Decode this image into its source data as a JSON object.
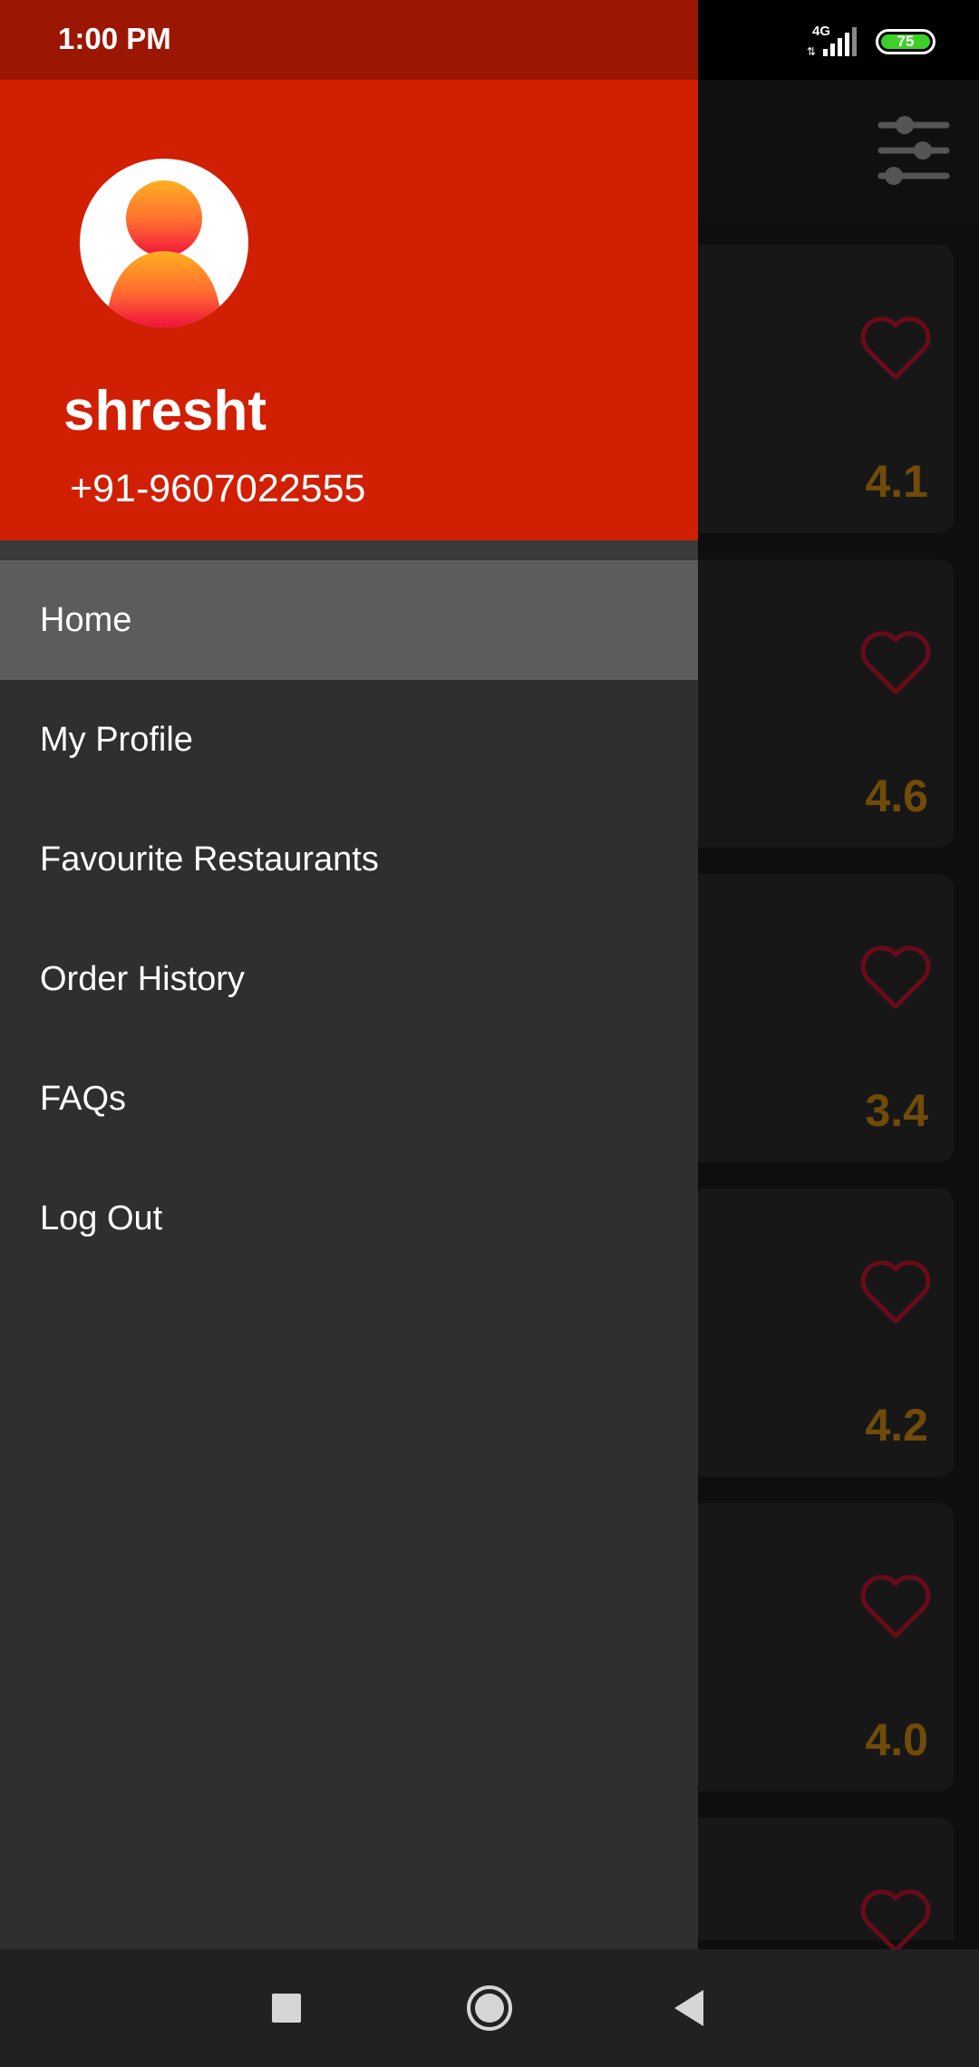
{
  "status_bar": {
    "time": "1:00 PM",
    "network": "4G",
    "battery": "75",
    "battery_level": 0.75
  },
  "drawer": {
    "user": {
      "name": "shresht",
      "phone": "+91-9607022555"
    },
    "menu": [
      {
        "label": "Home",
        "active": true
      },
      {
        "label": "My Profile",
        "active": false
      },
      {
        "label": "Favourite Restaurants",
        "active": false
      },
      {
        "label": "Order History",
        "active": false
      },
      {
        "label": "FAQs",
        "active": false
      },
      {
        "label": "Log Out",
        "active": false
      }
    ]
  },
  "background_list": {
    "filter_icon": "sliders-icon",
    "cards": [
      {
        "rating": "4.1",
        "icon": "heart-outline-icon"
      },
      {
        "rating": "4.6",
        "icon": "heart-outline-icon"
      },
      {
        "rating": "3.4",
        "icon": "heart-outline-icon"
      },
      {
        "rating": "4.2",
        "icon": "heart-outline-icon"
      },
      {
        "rating": "4.0",
        "icon": "heart-outline-icon"
      },
      {
        "rating": "",
        "icon": "heart-outline-icon"
      }
    ]
  },
  "nav_bar": {
    "buttons": [
      "recents-square-icon",
      "home-circle-icon",
      "back-triangle-icon"
    ]
  },
  "colors": {
    "header_red": "#d11f04",
    "status_red": "#9c1604",
    "drawer_bg": "#2f2f2f",
    "active_item": "#5c5c5c",
    "rating_gold": "#b57a10"
  }
}
